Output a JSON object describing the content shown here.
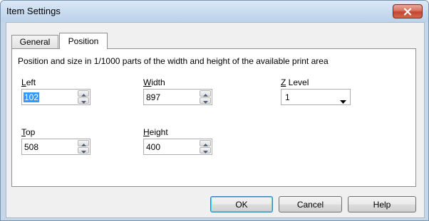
{
  "window": {
    "title": "Item Settings",
    "close_icon": "close-icon"
  },
  "tabs": [
    {
      "label": "General",
      "selected": false
    },
    {
      "label": "Position",
      "selected": true
    }
  ],
  "description": "Position and size in 1/1000 parts of the width and height of the available print area",
  "fields": {
    "left": {
      "mnemonic": "L",
      "rest": "eft",
      "value": "102"
    },
    "width": {
      "mnemonic": "W",
      "rest": "idth",
      "value": "897"
    },
    "top": {
      "mnemonic": "T",
      "rest": "op",
      "value": "508"
    },
    "height": {
      "mnemonic": "H",
      "rest": "eight",
      "value": "400"
    },
    "zlevel": {
      "mnemonic": "Z",
      "rest": " Level",
      "value": "1"
    }
  },
  "buttons": {
    "ok": "OK",
    "cancel": "Cancel",
    "help": "Help"
  },
  "colors": {
    "title_bar": "#c9dcf0",
    "close_button": "#c3442f",
    "selection": "#3399ff"
  }
}
